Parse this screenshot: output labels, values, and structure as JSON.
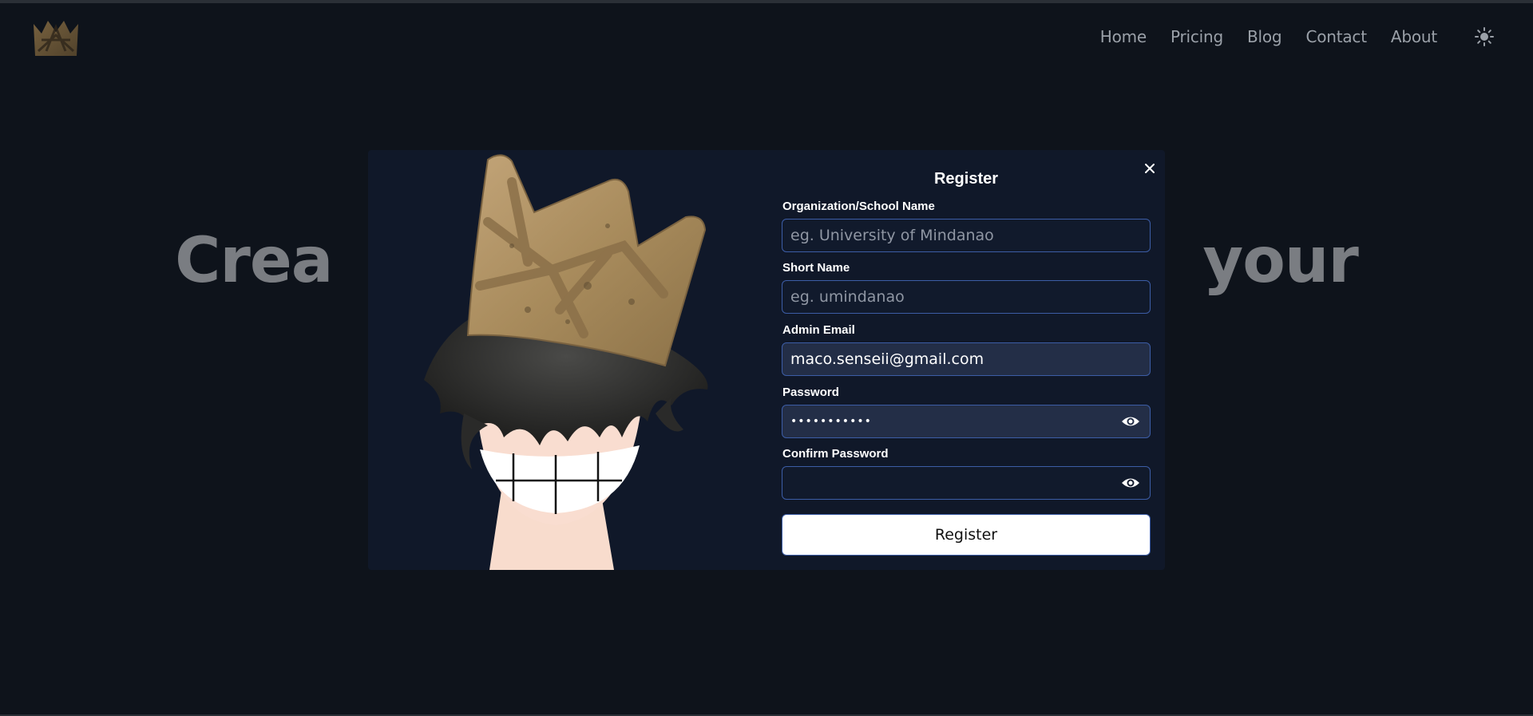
{
  "app": {
    "logo_icon": "crown-logo-icon"
  },
  "nav": {
    "items": [
      {
        "label": "Home"
      },
      {
        "label": "Pricing"
      },
      {
        "label": "Blog"
      },
      {
        "label": "Contact"
      },
      {
        "label": "About"
      }
    ],
    "theme_toggle_icon": "sun-icon"
  },
  "hero": {
    "left_text": "Crea",
    "right_text": "your"
  },
  "modal": {
    "title": "Register",
    "close_icon": "close-icon",
    "illustration": "crowned-smiling-character",
    "fields": {
      "org": {
        "label": "Organization/School Name",
        "value": "",
        "placeholder": "eg. University of Mindanao"
      },
      "short": {
        "label": "Short Name",
        "value": "",
        "placeholder": "eg. umindanao"
      },
      "email": {
        "label": "Admin Email",
        "value": "maco.senseii@gmail.com",
        "placeholder": ""
      },
      "password": {
        "label": "Password",
        "value": "•••••••••••",
        "placeholder": "",
        "toggle_icon": "eye-icon"
      },
      "confirm": {
        "label": "Confirm Password",
        "value": "",
        "placeholder": "",
        "toggle_icon": "eye-icon"
      }
    },
    "submit_label": "Register"
  },
  "colors": {
    "page_bg": "#0e131b",
    "modal_bg": "#101829",
    "field_border": "#3c5da6",
    "filled_field_bg": "#232e47",
    "nav_text": "#9aa0a8",
    "hero_text": "#7a7d82"
  }
}
